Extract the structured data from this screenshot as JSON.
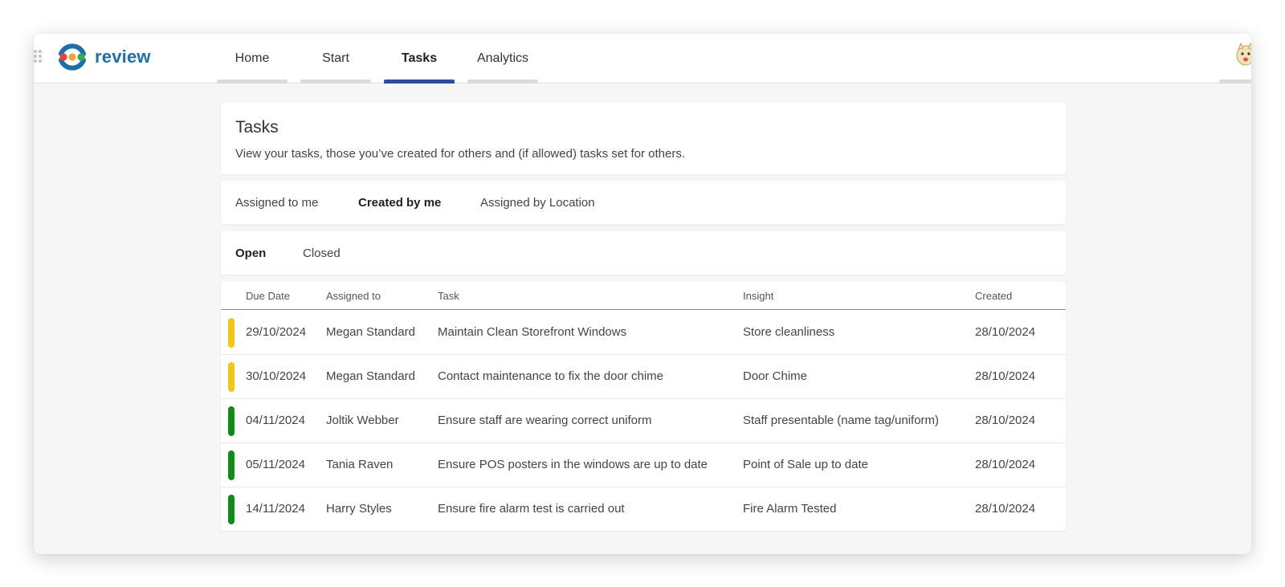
{
  "app": {
    "name": "review",
    "brand_color": "#1d6fa8"
  },
  "nav": {
    "tabs": [
      {
        "label": "Home",
        "active": false
      },
      {
        "label": "Start",
        "active": false
      },
      {
        "label": "Tasks",
        "active": true
      },
      {
        "label": "Analytics",
        "active": false
      }
    ],
    "active_color": "#2d4e9f"
  },
  "page": {
    "title": "Tasks",
    "description": "View your tasks, those you’ve created for others and (if allowed) tasks set for others."
  },
  "filter_tabs": {
    "items": [
      "Assigned to me",
      "Created by me",
      "Assigned by Location"
    ],
    "active": "Created by me"
  },
  "status_tabs": {
    "items": [
      "Open",
      "Closed"
    ],
    "active": "Open"
  },
  "table": {
    "columns": [
      "Due Date",
      "Assigned to",
      "Task",
      "Insight",
      "Created"
    ],
    "rows": [
      {
        "status_color": "#f5c518",
        "due": "29/10/2024",
        "assigned": "Megan Standard",
        "task": "Maintain Clean Storefront Windows",
        "insight": "Store cleanliness",
        "created": "28/10/2024"
      },
      {
        "status_color": "#f5c518",
        "due": "30/10/2024",
        "assigned": "Megan Standard",
        "task": "Contact maintenance to fix the door chime",
        "insight": "Door Chime",
        "created": "28/10/2024"
      },
      {
        "status_color": "#128a1a",
        "due": "04/11/2024",
        "assigned": "Joltik Webber",
        "task": "Ensure staff are wearing correct uniform",
        "insight": "Staff presentable (name tag/uniform)",
        "created": "28/10/2024"
      },
      {
        "status_color": "#128a1a",
        "due": "05/11/2024",
        "assigned": "Tania Raven",
        "task": "Ensure POS posters in the windows are up to date",
        "insight": "Point of Sale up to date",
        "created": "28/10/2024"
      },
      {
        "status_color": "#128a1a",
        "due": "14/11/2024",
        "assigned": "Harry Styles",
        "task": "Ensure fire alarm test is carried out",
        "insight": "Fire Alarm Tested",
        "created": "28/10/2024"
      }
    ]
  },
  "icons": {
    "logo": "review-logo-icon",
    "avatar": "user-avatar-icon",
    "grip": "app-launcher-grip-icon"
  }
}
